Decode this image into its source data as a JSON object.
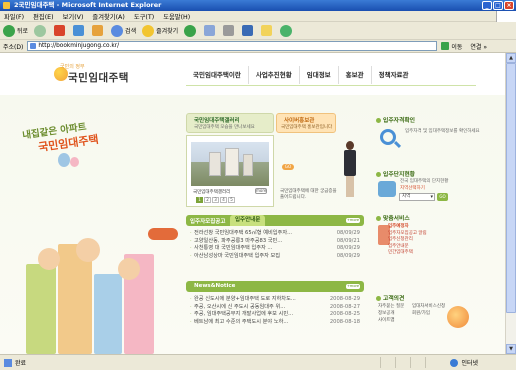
{
  "window": {
    "title": "2국민임대주택 - Microsoft Internet Explorer",
    "controls": [
      "_",
      "□",
      "×"
    ]
  },
  "menu": [
    "파일(F)",
    "편집(E)",
    "보기(V)",
    "즐겨찾기(A)",
    "도구(T)",
    "도움말(H)"
  ],
  "toolbar": {
    "back": "뒤로",
    "search": "검색",
    "favorites": "즐겨찾기"
  },
  "address": {
    "label": "주소(D)",
    "url": "http://bookminjugong.co.kr/",
    "go": "이동",
    "links": "연결 »"
  },
  "status": {
    "left": "완료",
    "zone": "인터넷"
  },
  "site": {
    "logo_small": "국민의 정부",
    "logo": "국민임대주택",
    "gnb": [
      "국민임대주택이란",
      "사업추진현황",
      "임대정보",
      "홍보관",
      "정책자료관"
    ],
    "slogan_line1": "내집같은 아파트",
    "slogan_line2": "국민임대주택",
    "gallery": {
      "title": "국민임대주택갤러리",
      "sub": "국민임대주택 모습을 만나보세요",
      "caption": "국민임대주택갤러리",
      "more": "more",
      "pages": [
        "1",
        "2",
        "3",
        "4",
        "5"
      ]
    },
    "cyber": {
      "title": "사이버홍보관",
      "sub": "국민임대주택 홍보관입니다",
      "go": "GO",
      "desc": "국민임대주택에 대한 궁금증을 풀어드립니다."
    },
    "tabs": {
      "t1": "입주자모집공고",
      "t2": "입주안내문",
      "more": "+more"
    },
    "notices": [
      {
        "text": "전라선창 국민임대주택 65㎡형 예비입주자...",
        "date": "08/09/29"
      },
      {
        "text": "고양일산동, 파주공릉3 마주공83 국민...",
        "date": "08/09/21"
      },
      {
        "text": "사천통영 대 국민임대주택 입주자 ...",
        "date": "08/09/29"
      },
      {
        "text": "아산남성상마 국민임대주택 입주자 모집",
        "date": "08/09/29"
      }
    ],
    "news": {
      "title": "News&Notice",
      "more": "+more",
      "items": [
        {
          "text": "완공 신도시에 분양+임대주택 도로 지하차도...",
          "date": "2008-08-29"
        },
        {
          "text": "주공, 오산시에 신 주도시 공동임대주 위...",
          "date": "2008-08-27"
        },
        {
          "text": "주공, 임대주택공부지 개발사업에 후보 시민...",
          "date": "2008-08-25"
        },
        {
          "text": "베트남에 최고 수준의 주택도시 분야 노하...",
          "date": "2008-08-18"
        }
      ]
    },
    "right": {
      "check_title": "입주자격확인",
      "check_desc": "입주자격 및 임대주택정보를 확인하세요",
      "complex_title": "입주단지현황",
      "complex_desc": "전국 임대주택의 단지현황",
      "region_label": "지역선택하기",
      "region_value": "지역",
      "region_go": "GO",
      "service_title": "맞춤서비스",
      "services": [
        "입주예정자",
        "입주자모집공고 알림",
        "입주신청관리",
        "입주안내문",
        "민간임대주택"
      ],
      "customer_title": "고객의견",
      "customer_links": [
        "자주묻는 질문",
        "정보공개",
        "사이트맵",
        "임대차서비스신청",
        "회원/가입"
      ]
    }
  }
}
